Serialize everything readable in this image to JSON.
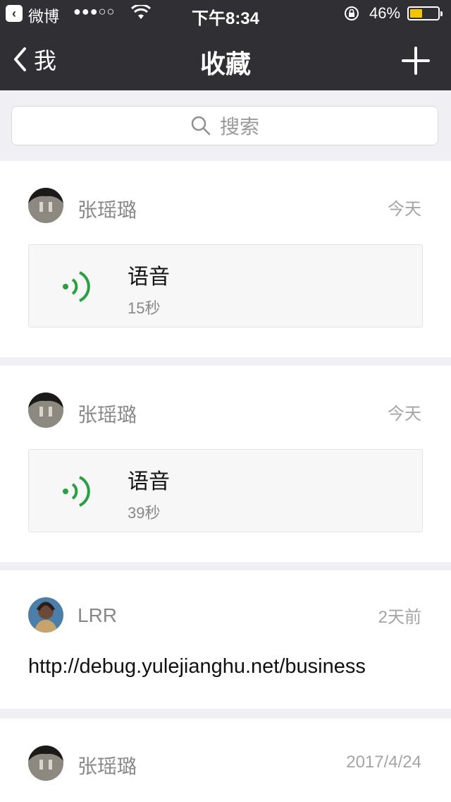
{
  "status_bar": {
    "back_app": "微博",
    "signal": "●●●○○",
    "time": "下午8:34",
    "battery_pct": "46%",
    "battery_level": 0.46
  },
  "nav": {
    "back_label": "我",
    "title": "收藏"
  },
  "search": {
    "placeholder": "搜索"
  },
  "items": [
    {
      "name": "张瑶璐",
      "when": "今天",
      "type": "voice",
      "label": "语音",
      "duration": "15秒"
    },
    {
      "name": "张瑶璐",
      "when": "今天",
      "type": "voice",
      "label": "语音",
      "duration": "39秒"
    },
    {
      "name": "LRR",
      "when": "2天前",
      "type": "link",
      "text": "http://debug.yulejianghu.net/business"
    },
    {
      "name": "张瑶璐",
      "when": "2017/4/24"
    }
  ],
  "colors": {
    "nav_bg": "#2f2f34",
    "voice_accent": "#2aa043",
    "page_bg": "#efeff4"
  }
}
